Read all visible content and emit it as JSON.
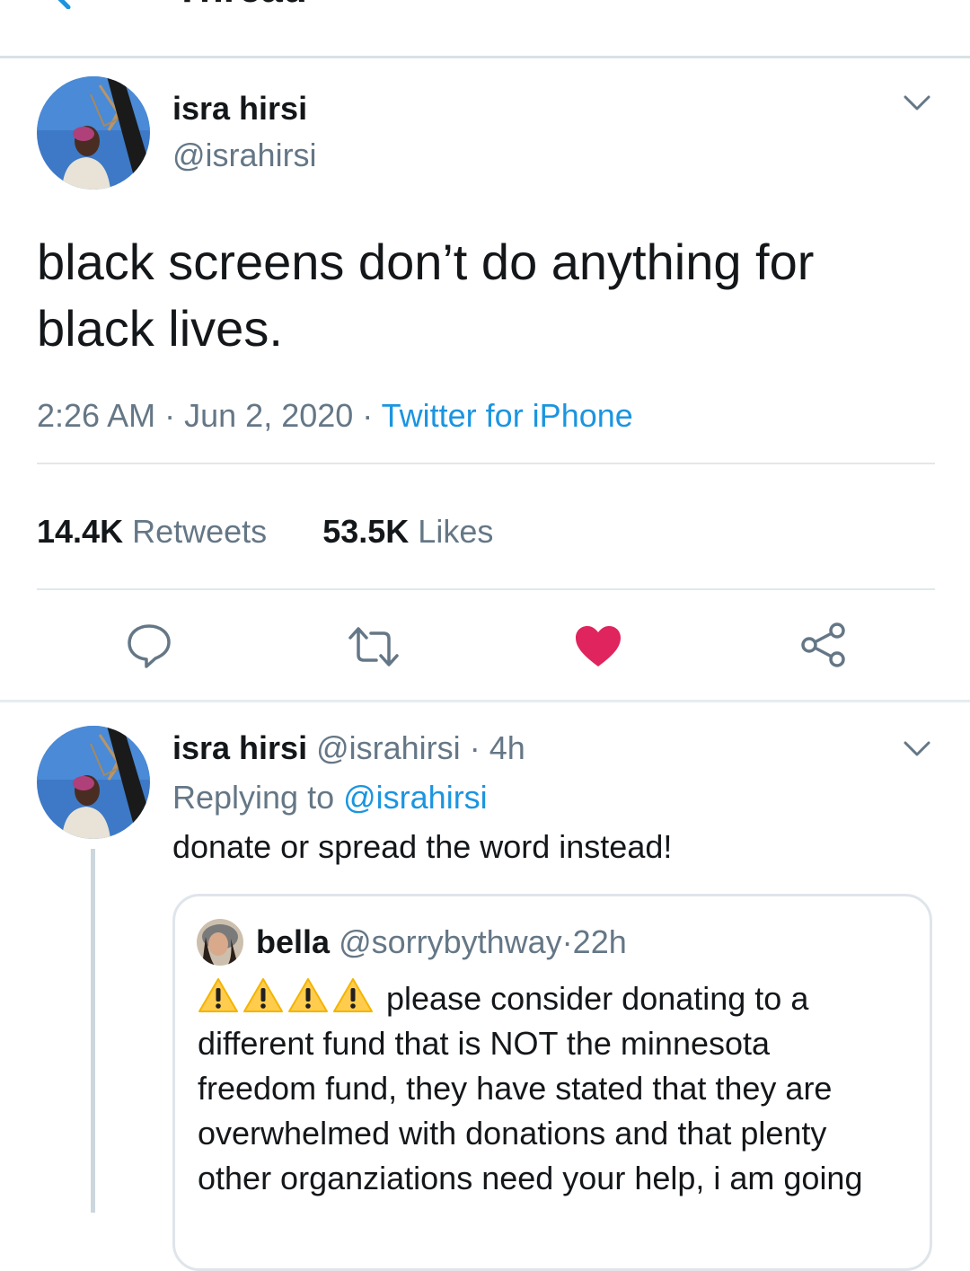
{
  "header": {
    "title": "Thread"
  },
  "main_tweet": {
    "name": "isra hirsi",
    "handle": "@israhirsi",
    "text_line1": "black screens don’t do anything for",
    "text_line2": "black lives.",
    "time": "2:26 AM",
    "sep1": "·",
    "date": "Jun 2, 2020",
    "sep2": "·",
    "source": "Twitter for iPhone",
    "retweets_count": "14.4K",
    "retweets_label": "Retweets",
    "likes_count": "53.5K",
    "likes_label": "Likes",
    "liked": true
  },
  "reply_tweet": {
    "name": "isra hirsi",
    "handle": "@israhirsi",
    "sep": "·",
    "age": "4h",
    "replying_prefix": "Replying to",
    "replying_to": "@israhirsi",
    "text": "donate or spread the word instead!"
  },
  "quoted_tweet": {
    "name": "bella",
    "handle": "@sorrybythway",
    "sep": "·",
    "age": "22h",
    "line1": "please consider donating to a",
    "line2": "different fund that is NOT the minnesota",
    "line3": "freedom fund, they have stated that they are",
    "line4": "overwhelmed with donations and that plenty",
    "line5": "other organziations need your help, i am going"
  },
  "icons": {
    "reply": "reply-icon",
    "retweet": "retweet-icon",
    "like": "heart-icon",
    "share": "share-icon",
    "more": "chevron-down-icon",
    "warning": "warning-icon"
  },
  "colors": {
    "link_blue": "#1b95e0",
    "like_red": "#e0245e",
    "secondary_text": "#657786",
    "divider": "#e1e8ed"
  }
}
